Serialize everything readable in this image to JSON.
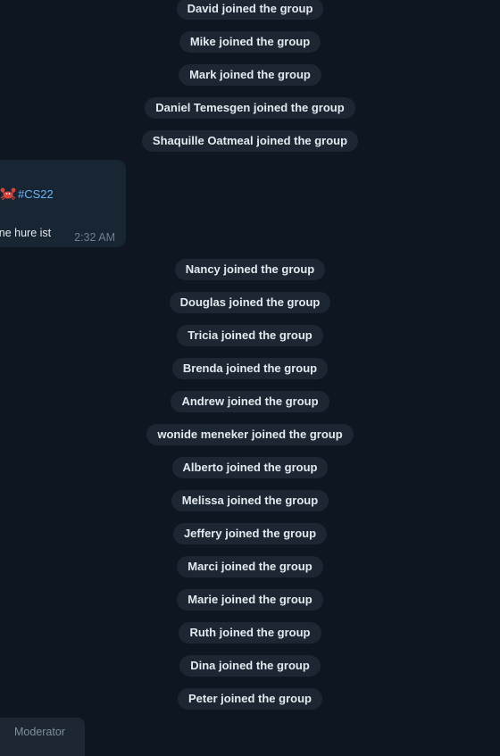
{
  "service_messages_top": [
    "David joined the group",
    "Mike joined the group",
    "Mark joined the group",
    "Daniel Temesgen joined the group",
    "Shaquille Oatmeal joined the group"
  ],
  "message": {
    "hashtag": "#CS22",
    "text": "ine hure ist",
    "time": "2:32 AM",
    "icon": "crab-icon"
  },
  "service_messages_bottom": [
    "Nancy joined the group",
    "Douglas joined the group",
    "Tricia joined the group",
    "Brenda joined the group",
    "Andrew joined the group",
    "wonide meneker joined the group",
    "Alberto joined the group",
    "Melissa joined the group",
    "Jeffery joined the group",
    "Marci joined the group",
    "Marie joined the group",
    "Ruth joined the group",
    "Dina joined the group",
    "Peter joined the group"
  ],
  "moderator": {
    "label": "Moderator"
  },
  "colors": {
    "background": "#0e1621",
    "pill": "#1c2733",
    "bubble": "#182533",
    "link": "#6ab3f3",
    "time": "#6d7f8f"
  }
}
